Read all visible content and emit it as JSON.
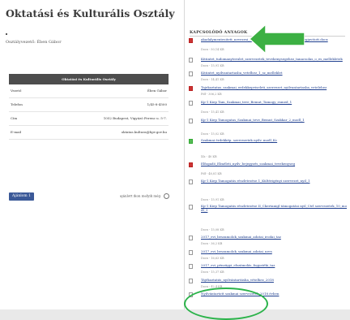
{
  "page": {
    "title": "Oktatási és Kulturális Osztály",
    "leader": "Osztályvezető: Ében Gábor"
  },
  "contact": {
    "header": "Oktatási és Kulturális Osztály",
    "rows": [
      {
        "label": "Vezető",
        "value": "Ében Gábor"
      },
      {
        "label": "Telefon",
        "value": "1/45-8-4500"
      },
      {
        "label": "Cím",
        "value": "1052 Budapest, Vigyázó Ferenc u. 5-7."
      },
      {
        "label": "E-mail",
        "value": "oktatas.kultura@bpv.gov.hu"
      }
    ]
  },
  "facebook": {
    "button": "Ajánlom 1",
    "note": "ajánlott ikon melyik még"
  },
  "related": {
    "heading": "KAPCSOLÓDÓ ANYAGOK",
    "docs": [
      {
        "name": "akadalymentesitett_nevezesi_lap_2018_tavaszi_palyazathoz_megjavitott.docx",
        "meta": "Docx - 50,14 KB",
        "icon": "pdf-icon"
      },
      {
        "name": "Kitüntet_tudomanyterulet_szervezetek_tevekenysegehez_tanacsolas_o_es_mellekletek",
        "meta": "Docx - 15,91 KB",
        "icon": "doc-icon"
      },
      {
        "name": "Kitüntet_nyilvantartasba_vetelhez_1_sz_melleklet",
        "meta": "Docx - 14,41 KB",
        "icon": "doc-icon"
      },
      {
        "name": "Tajekoztatas_szakmai_erdekkepviseleti_szervezet_nyilvantartasba_vetelehez",
        "meta": "Pdf - 306,2 KB",
        "icon": "pdf-icon"
      },
      {
        "name": "Kp-1 Kiep Tam_Szakmai_teve_Bemut_Tamogy_esmed_1",
        "meta": "Docx - 15,41 KB",
        "icon": "doc-icon"
      },
      {
        "name": "Kp-1 Kiep Tamogatas_Szakmai_teve_Bemut_Szakkar_2_modl_1",
        "meta": "Docx - 15,02 KB",
        "icon": "doc-icon"
      },
      {
        "name": "Szakmai érdekkép. szervezetek nyilv. modl_Kc",
        "meta": "Xls - 40 KB",
        "icon": "img-icon"
      },
      {
        "name": "Elfogadó_Elméleti_nyilv_bejegyzés_szakmai_tevekenyseg",
        "meta": "Pdf - 48,81 KB",
        "icon": "pdf-icon"
      },
      {
        "name": "Kp-1 Kiep Tamogatás részletezése 1_Kültérigényi szervezet_nyil_1",
        "meta": "Docx - 15,91 KB",
        "icon": "doc-icon"
      },
      {
        "name": "Kp-1 Kiep Tamogatás részletezése II_Ckertanigl támogatási nyil_Ctrl szervezetek_10_modl_1",
        "meta": "Docx - 15,08 KB",
        "icon": "doc-icon"
      },
      {
        "name": "2017_evi_beszamolok_szakmai_adatai_irodai_taz",
        "meta": "Docx - 36,2 KB",
        "icon": "doc-icon"
      },
      {
        "name": "2017_evi_beszamolok_szakmai_adatai_ures",
        "meta": "Docx - 16,63 KB",
        "icon": "doc-icon"
      },
      {
        "name": "2017_evi_pénzügyi_elszámolás_fogyatéki_taz",
        "meta": "Docx - 15,37 KB",
        "icon": "doc-icon"
      },
      {
        "name": "Tájékoztatás_nyilvántartásba_vételhez_2018",
        "meta": "Docx - 42,4 KB",
        "icon": "doc-icon"
      },
      {
        "name": "Nyilvántartott szakmai szervezetek 2018 évben",
        "meta": "",
        "icon": "doc-icon"
      }
    ]
  },
  "annotations": {
    "arrow_color": "#3cb043",
    "ellipse_color": "#2bb34a"
  }
}
